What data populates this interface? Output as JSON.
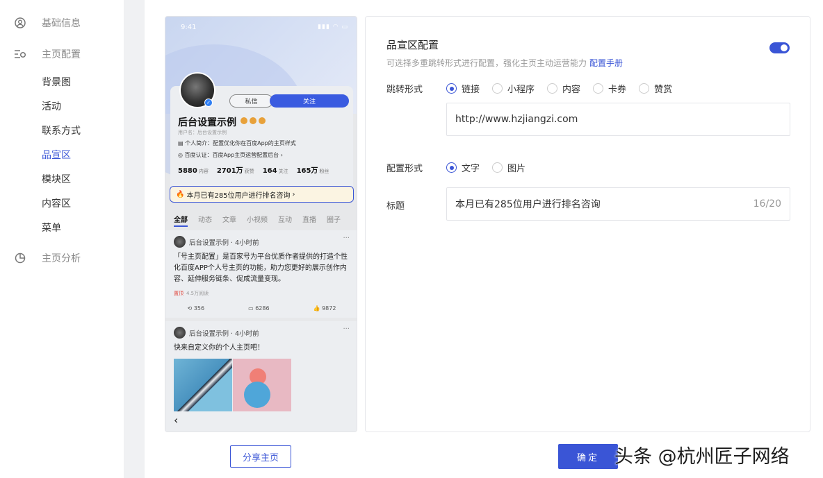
{
  "sidebar": {
    "items": [
      {
        "label": "基础信息",
        "icon": "user-circle-icon"
      },
      {
        "label": "主页配置",
        "icon": "layout-settings-icon"
      },
      {
        "label": "背景图"
      },
      {
        "label": "活动"
      },
      {
        "label": "联系方式"
      },
      {
        "label": "品宣区"
      },
      {
        "label": "模块区"
      },
      {
        "label": "内容区"
      },
      {
        "label": "菜单"
      },
      {
        "label": "主页分析",
        "icon": "pie-chart-icon"
      }
    ],
    "active": "品宣区"
  },
  "preview": {
    "status_time": "9:41",
    "btn_message": "私信",
    "btn_follow": "关注",
    "name": "后台设置示例",
    "username": "用户名：后台设置示例",
    "intro": "个人简介：配置优化你在百度App的主页样式",
    "certification": "百度认证：百度App主页运营配置后台",
    "stats": [
      {
        "num": "5880",
        "label": "内容"
      },
      {
        "num": "2701万",
        "label": "获赞"
      },
      {
        "num": "164",
        "label": "关注"
      },
      {
        "num": "165万",
        "label": "粉丝"
      }
    ],
    "rank_text": "本月已有285位用户进行排名咨询",
    "tabs": [
      "全部",
      "动态",
      "文章",
      "小视频",
      "互动",
      "直播",
      "圈子"
    ],
    "post1": {
      "author": "后台设置示例 · 4小时前",
      "text": "「号主页配置」是百家号为平台优质作者提供的打造个性化百度APP个人号主页的功能，助力您更好的展示创作内容、延伸服务链条、促成流量变现。",
      "pinned": "置顶",
      "reads": "4.5万阅读",
      "reposts": "356",
      "comments": "6286",
      "likes": "9872"
    },
    "post2": {
      "author": "后台设置示例 · 4小时前",
      "text": "快来自定义你的个人主页吧！"
    }
  },
  "config": {
    "title": "品宣区配置",
    "description": "可选择多重跳转形式进行配置，强化主页主动运营能力",
    "manual_link": "配置手册",
    "toggle_on": true,
    "jump_label": "跳转形式",
    "jump_options": [
      "链接",
      "小程序",
      "内容",
      "卡券",
      "赞赏"
    ],
    "jump_selected": "链接",
    "url_value": "http://www.hzjiangzi.com",
    "format_label": "配置形式",
    "format_options": [
      "文字",
      "图片"
    ],
    "format_selected": "文字",
    "title_label": "标题",
    "title_value": "本月已有285位用户进行排名咨询",
    "title_count": "16/20"
  },
  "buttons": {
    "share": "分享主页",
    "confirm": "确定"
  },
  "watermark": "头条 @杭州匠子网络",
  "colors": {
    "accent": "#3a55d6"
  }
}
